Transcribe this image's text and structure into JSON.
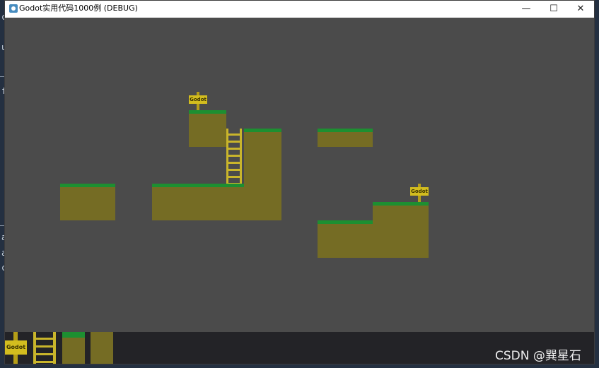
{
  "window": {
    "title": "Godot实用代码1000例 (DEBUG)",
    "controls": {
      "minimize": "—",
      "maximize": "☐",
      "close": "✕"
    }
  },
  "game": {
    "signs": [
      {
        "label": "Godot"
      },
      {
        "label": "Godot"
      }
    ]
  },
  "palette": {
    "sign_label": "Godot"
  },
  "background_editor": {
    "fragments": [
      "c",
      "u",
      "f",
      "a",
      "a",
      "c"
    ]
  },
  "colors": {
    "sky": "#4b4b4b",
    "dirt": "#756c24",
    "grass": "#1d8f31",
    "ladder": "#c9b52b",
    "sign": "#d3bd1f",
    "palette_bg": "#232327"
  },
  "watermark": "CSDN @巽星石"
}
